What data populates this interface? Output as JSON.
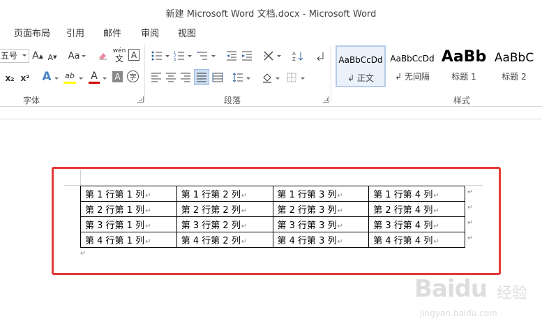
{
  "window": {
    "title": "新建 Microsoft Word 文档.docx - Microsoft Word"
  },
  "menu": {
    "items": [
      "页面布局",
      "引用",
      "邮件",
      "审阅",
      "视图"
    ]
  },
  "ribbon": {
    "font": {
      "size_value": "五号",
      "case_label": "Aa",
      "group_label": "字体",
      "phonetic_top": "wén",
      "phonetic_bottom": "文",
      "boxed_char": "A",
      "subscript_label": "x₂",
      "superscript_label": "x²",
      "circled_char": "字",
      "grow_label": "A",
      "shrink_label": "A",
      "effects_label": "A",
      "highlight_label": "ab",
      "font_color_label": "A",
      "shading_label": "A"
    },
    "paragraph": {
      "group_label": "段落"
    },
    "styles": {
      "group_label": "样式",
      "tiles": [
        {
          "sample": "AaBbCcDd",
          "name": "↲ 正文",
          "selected": true
        },
        {
          "sample": "AaBbCcDd",
          "name": "↲ 无间隔",
          "selected": false
        },
        {
          "sample": "AaBb",
          "name": "标题 1",
          "selected": false
        },
        {
          "sample": "AaBbC",
          "name": "标题 2",
          "selected": false
        }
      ]
    }
  },
  "document": {
    "table": [
      [
        "第 1 行第 1 列",
        "第 1 行第 2 列",
        "第 1 行第 3 列",
        "第 1 行第 4 列"
      ],
      [
        "第 2 行第 1 列",
        "第 2 行第 2 列",
        "第 2 行第 3 列",
        "第 2 行第 4 列"
      ],
      [
        "第 3 行第 1 列",
        "第 3 行第 2 列",
        "第 3 行第 3 列",
        "第 3 行第 4 列"
      ],
      [
        "第 4 行第 1 列",
        "第 4 行第 2 列",
        "第 4 行第 3 列",
        "第 4 行第 4 列"
      ]
    ],
    "mark": "↵",
    "highlight_color": "#e53935"
  },
  "watermark": {
    "logo": "Baidu",
    "logo_suffix": "经验",
    "url": "jingyan.baidu.com"
  }
}
